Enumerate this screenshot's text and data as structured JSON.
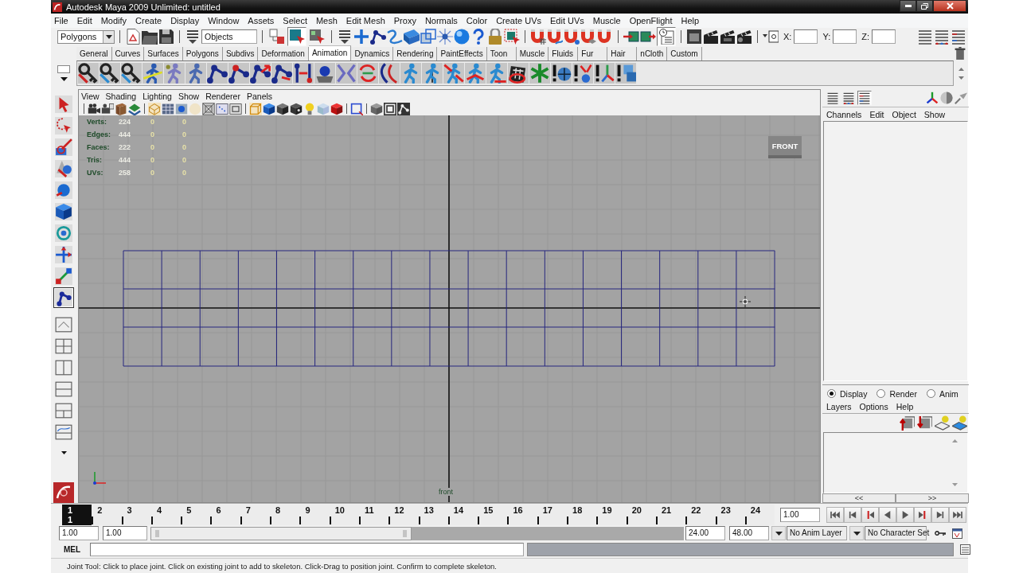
{
  "window": {
    "title": "Autodesk Maya 2009 Unlimited: untitled"
  },
  "menu_bar": [
    "File",
    "Edit",
    "Modify",
    "Create",
    "Display",
    "Window",
    "Assets",
    "Select",
    "Mesh",
    "Edit Mesh",
    "Proxy",
    "Normals",
    "Color",
    "Create UVs",
    "Edit UVs",
    "Muscle",
    "OpenFlight",
    "Help"
  ],
  "status_line": {
    "menu_set": "Polygons",
    "selection_mask": "Objects",
    "selection_modes": [
      {
        "selected": false
      },
      {
        "selected": true
      },
      {
        "selected": false
      }
    ],
    "construction_history": {
      "on": true
    },
    "coordinate_fields": [
      {
        "label": "X:"
      },
      {
        "label": "Y:"
      },
      {
        "label": "Z:"
      }
    ]
  },
  "shelf": {
    "tabs": [
      {
        "label": "General",
        "selected": false
      },
      {
        "label": "Curves",
        "selected": false
      },
      {
        "label": "Surfaces",
        "selected": false
      },
      {
        "label": "Polygons",
        "selected": false
      },
      {
        "label": "Subdivs",
        "selected": false
      },
      {
        "label": "Deformation",
        "selected": false
      },
      {
        "label": "Animation",
        "selected": true
      },
      {
        "label": "Dynamics",
        "selected": false
      },
      {
        "label": "Rendering",
        "selected": false
      },
      {
        "label": "PaintEffects",
        "selected": false
      },
      {
        "label": "Toon",
        "selected": false
      },
      {
        "label": "Muscle",
        "selected": false
      },
      {
        "label": "Fluids",
        "selected": false
      },
      {
        "label": "Fur",
        "selected": false
      },
      {
        "label": "Hair",
        "selected": false
      },
      {
        "label": "nCloth",
        "selected": false
      },
      {
        "label": "Custom",
        "selected": false
      }
    ]
  },
  "toolbox": {
    "tools": [
      {
        "selected": false
      },
      {
        "selected": false
      },
      {
        "selected": false
      },
      {
        "selected": false
      },
      {
        "selected": false
      },
      {
        "selected": false
      },
      {
        "selected": false
      },
      {
        "selected": false
      },
      {
        "selected": false
      },
      {
        "selected": true
      }
    ]
  },
  "viewport": {
    "menus": [
      "View",
      "Shading",
      "Lighting",
      "Show",
      "Renderer",
      "Panels"
    ],
    "hud_stats": [
      {
        "label": "Verts:",
        "values": [
          "224",
          "0",
          "0"
        ]
      },
      {
        "label": "Edges:",
        "values": [
          "444",
          "0",
          "0"
        ]
      },
      {
        "label": "Faces:",
        "values": [
          "222",
          "0",
          "0"
        ]
      },
      {
        "label": "Tris:",
        "values": [
          "444",
          "0",
          "0"
        ]
      },
      {
        "label": "UVs:",
        "values": [
          "258",
          "0",
          "0"
        ]
      }
    ],
    "view_cube_label": "FRONT",
    "camera_label": "front"
  },
  "channel_box": {
    "layout_modes": [
      {
        "selected": false
      },
      {
        "selected": false
      },
      {
        "selected": true
      }
    ],
    "menus": [
      "Channels",
      "Edit",
      "Object",
      "Show"
    ]
  },
  "layer_editor": {
    "modes": [
      {
        "label": "Display",
        "selected": true
      },
      {
        "label": "Render",
        "selected": false
      },
      {
        "label": "Anim",
        "selected": false
      }
    ],
    "menus": [
      "Layers",
      "Options",
      "Help"
    ],
    "scroll_buttons": [
      "<<",
      ">>"
    ]
  },
  "time_slider": {
    "frames": [
      {
        "label": "1",
        "selected": true
      },
      {
        "label": "2",
        "selected": false
      },
      {
        "label": "3",
        "selected": false
      },
      {
        "label": "4",
        "selected": false
      },
      {
        "label": "5",
        "selected": false
      },
      {
        "label": "6",
        "selected": false
      },
      {
        "label": "7",
        "selected": false
      },
      {
        "label": "8",
        "selected": false
      },
      {
        "label": "9",
        "selected": false
      },
      {
        "label": "10",
        "selected": false
      },
      {
        "label": "11",
        "selected": false
      },
      {
        "label": "12",
        "selected": false
      },
      {
        "label": "13",
        "selected": false
      },
      {
        "label": "14",
        "selected": false
      },
      {
        "label": "15",
        "selected": false
      },
      {
        "label": "16",
        "selected": false
      },
      {
        "label": "17",
        "selected": false
      },
      {
        "label": "18",
        "selected": false
      },
      {
        "label": "19",
        "selected": false
      },
      {
        "label": "20",
        "selected": false
      },
      {
        "label": "21",
        "selected": false
      },
      {
        "label": "22",
        "selected": false
      },
      {
        "label": "23",
        "selected": false
      },
      {
        "label": "24",
        "selected": false
      }
    ],
    "current_frame": "1",
    "current_time": "1.00"
  },
  "range_slider": {
    "start_time": "1.00",
    "playback_start": "1.00",
    "level": 0.49,
    "playback_end": "24.00",
    "end_time": "48.00",
    "anim_layer": "No Anim Layer",
    "character_set": "No Character Set"
  },
  "command_line": {
    "label": "MEL"
  },
  "help_line": "Joint Tool: Click to place joint. Click on existing joint to add to skeleton. Click-Drag to position joint. Confirm to complete skeleton."
}
